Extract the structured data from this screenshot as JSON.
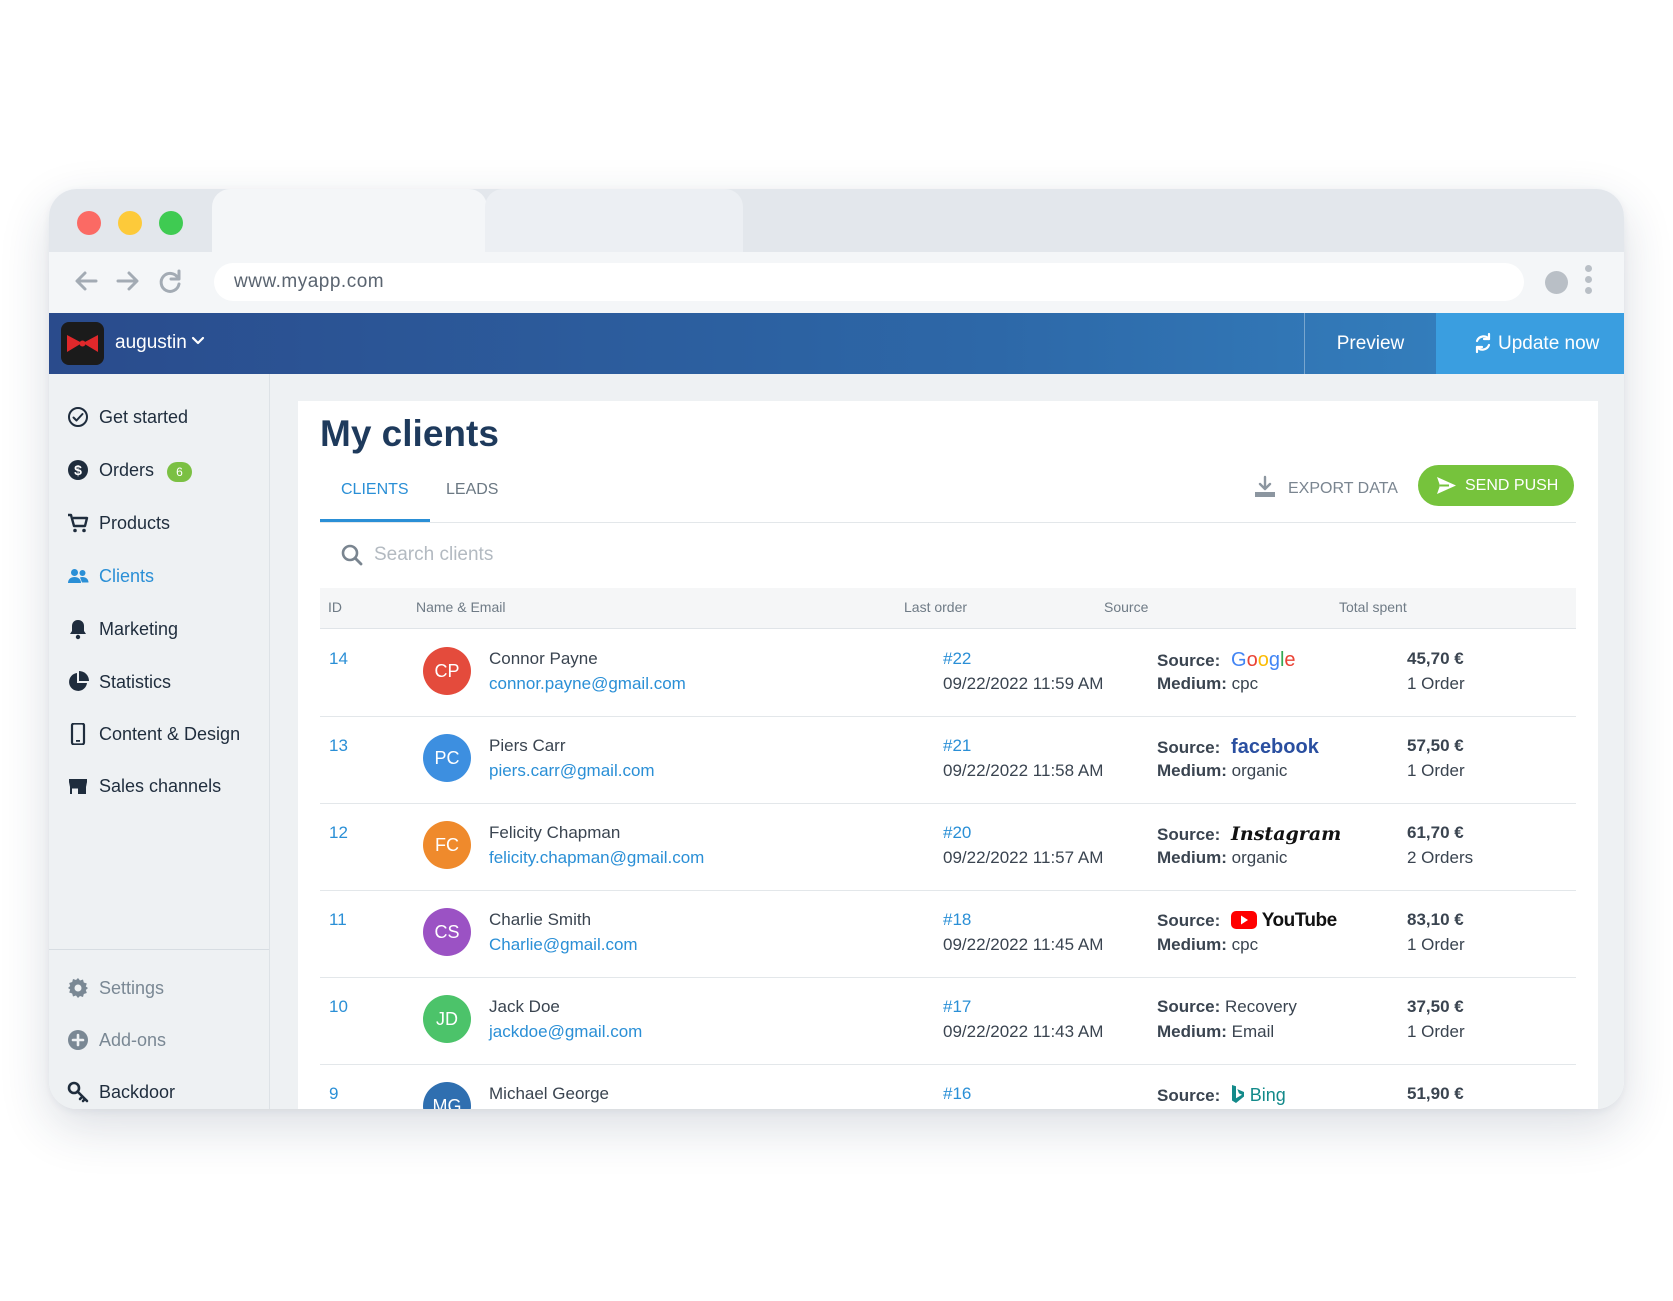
{
  "browser": {
    "url": "www.myapp.com"
  },
  "header": {
    "workspace": "augustin",
    "preview_label": "Preview",
    "update_label": "Update now"
  },
  "sidebar": {
    "items": [
      {
        "label": "Get started",
        "icon": "check-circle-icon"
      },
      {
        "label": "Orders",
        "icon": "dollar-circle-icon",
        "badge": "6"
      },
      {
        "label": "Products",
        "icon": "cart-icon"
      },
      {
        "label": "Clients",
        "icon": "users-icon"
      },
      {
        "label": "Marketing",
        "icon": "bell-icon"
      },
      {
        "label": "Statistics",
        "icon": "pie-chart-icon"
      },
      {
        "label": "Content & Design",
        "icon": "phone-icon"
      },
      {
        "label": "Sales channels",
        "icon": "store-icon"
      }
    ],
    "bottom_items": [
      {
        "label": "Settings",
        "icon": "gear-icon"
      },
      {
        "label": "Add-ons",
        "icon": "plus-circle-icon"
      },
      {
        "label": "Backdoor",
        "icon": "key-icon"
      }
    ]
  },
  "main": {
    "title": "My clients",
    "tabs": [
      "CLIENTS",
      "LEADS"
    ],
    "export_label": "EXPORT DATA",
    "send_push_label": "SEND PUSH",
    "search_placeholder": "Search clients",
    "columns": [
      "ID",
      "Name & Email",
      "Last order",
      "Source",
      "Total spent"
    ],
    "source_label": "Source:",
    "medium_label": "Medium:",
    "rows": [
      {
        "id": "14",
        "initials": "CP",
        "avatar_color": "#e44b3c",
        "name": "Connor Payne",
        "email": "connor.payne@gmail.com",
        "order": "#22",
        "date": "09/22/2022 11:59 AM",
        "source": "Google",
        "medium": "cpc",
        "amount": "45,70 €",
        "orders": "1 Order"
      },
      {
        "id": "13",
        "initials": "PC",
        "avatar_color": "#3d8fe0",
        "name": "Piers Carr",
        "email": "piers.carr@gmail.com",
        "order": "#21",
        "date": "09/22/2022 11:58 AM",
        "source": "facebook",
        "medium": "organic",
        "amount": "57,50 €",
        "orders": "1 Order"
      },
      {
        "id": "12",
        "initials": "FC",
        "avatar_color": "#ef8a2c",
        "name": "Felicity Chapman",
        "email": "felicity.chapman@gmail.com",
        "order": "#20",
        "date": "09/22/2022 11:57 AM",
        "source": "Instagram",
        "medium": "organic",
        "amount": "61,70 €",
        "orders": "2 Orders"
      },
      {
        "id": "11",
        "initials": "CS",
        "avatar_color": "#9b52c4",
        "name": "Charlie Smith",
        "email": "Charlie@gmail.com",
        "order": "#18",
        "date": "09/22/2022 11:45 AM",
        "source": "YouTube",
        "medium": "cpc",
        "amount": "83,10 €",
        "orders": "1 Order"
      },
      {
        "id": "10",
        "initials": "JD",
        "avatar_color": "#4cc36a",
        "name": "Jack Doe",
        "email": "jackdoe@gmail.com",
        "order": "#17",
        "date": "09/22/2022 11:43 AM",
        "source": "Recovery",
        "medium": "Email",
        "amount": "37,50 €",
        "orders": "1 Order"
      },
      {
        "id": "9",
        "initials": "MG",
        "avatar_color": "#2f6fb0",
        "name": "Michael George",
        "email": "",
        "order": "#16",
        "date": "",
        "source": "Bing",
        "medium": "",
        "amount": "51,90 €",
        "orders": ""
      }
    ]
  }
}
